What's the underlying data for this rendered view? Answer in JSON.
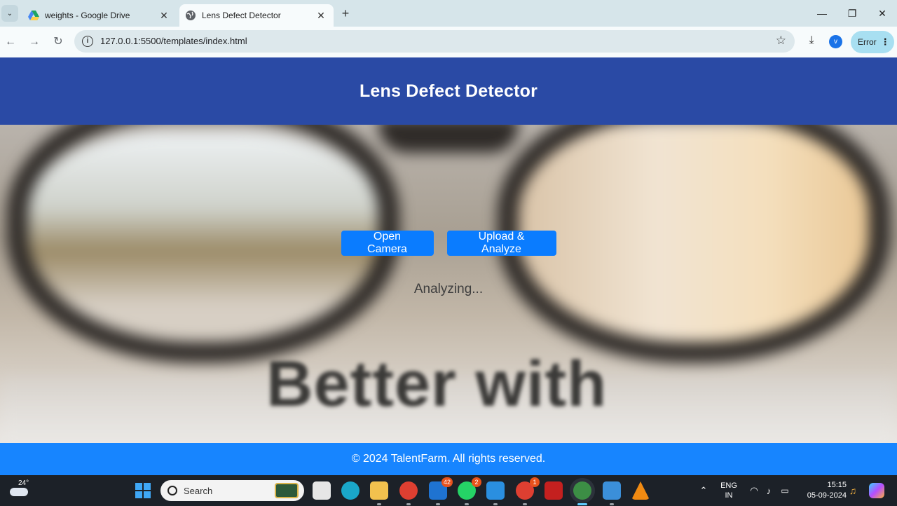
{
  "browser": {
    "tabs": [
      {
        "title": "weights - Google Drive",
        "icon": "google-drive-icon",
        "active": false
      },
      {
        "title": "Lens Defect Detector",
        "icon": "globe-icon",
        "active": true
      }
    ],
    "url": "127.0.0.1:5500/templates/index.html",
    "profile_initial": "v",
    "error_label": "Error"
  },
  "page": {
    "header_title": "Lens Defect Detector",
    "hero_watermark": "Better with",
    "buttons": {
      "open_camera": "Open Camera",
      "upload_analyze": "Upload & Analyze"
    },
    "status": "Analyzing...",
    "footer": "© 2024 TalentFarm. All rights reserved."
  },
  "taskbar": {
    "weather_temp": "24°",
    "search_label": "Search",
    "badges": {
      "mail": "42",
      "whatsapp": "2",
      "chrome_profile": "1"
    },
    "lang_line1": "ENG",
    "lang_line2": "IN",
    "time": "15:15",
    "date": "05-09-2024"
  },
  "colors": {
    "header_bg": "#2a4aa5",
    "button_bg": "#0a7cff",
    "footer_bg": "#1785ff"
  }
}
